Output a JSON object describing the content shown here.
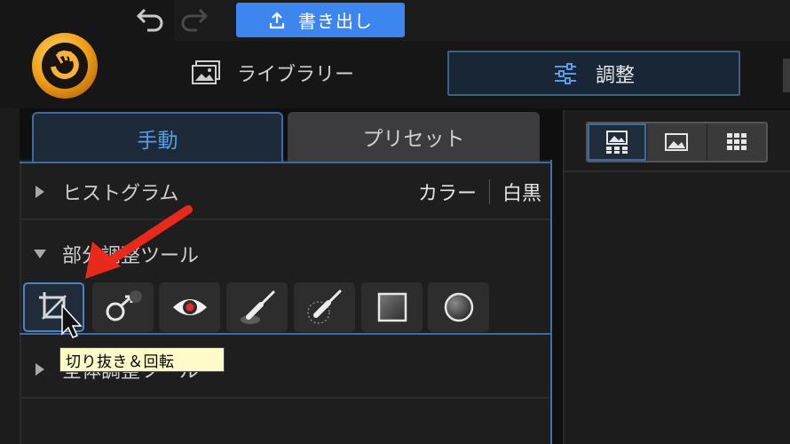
{
  "header": {
    "export_label": "書き出し",
    "library_label": "ライブラリー",
    "adjust_label": "調整"
  },
  "tabs": {
    "manual": "手動",
    "preset": "プリセット"
  },
  "histogram": {
    "title": "ヒストグラム",
    "color_option": "カラー",
    "mono_option": "白黒"
  },
  "local_tools": {
    "title": "部分調整ツール"
  },
  "global_tools": {
    "title": "全体調整ツール"
  },
  "tooltip": {
    "text": "切り抜き＆回転"
  },
  "colors": {
    "accent": "#3d86f0",
    "active_tab_text": "#5a9ce6",
    "annotation_arrow": "#e8291c"
  }
}
